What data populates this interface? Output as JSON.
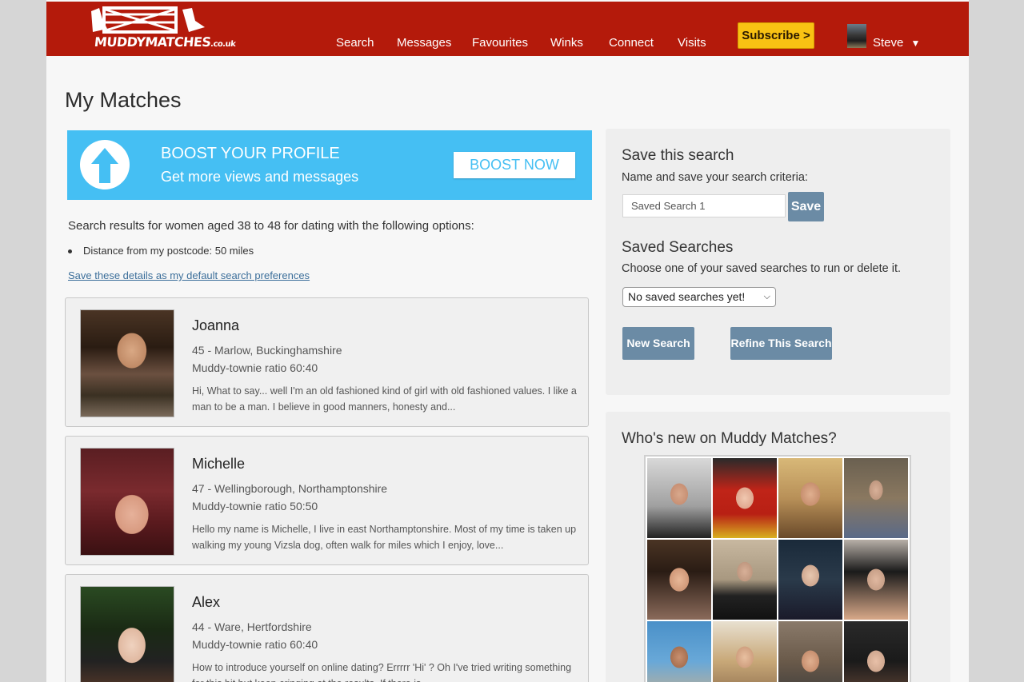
{
  "header": {
    "logo_text": "MUDDYMATCHES",
    "logo_domain": ".co.uk",
    "nav": [
      "Search",
      "Messages",
      "Favourites",
      "Winks",
      "Connect",
      "Visits"
    ],
    "subscribe_label": "Subscribe >",
    "user": {
      "name": "Steve",
      "caret": "▼"
    }
  },
  "main": {
    "title": "My Matches",
    "boost": {
      "heading": "BOOST YOUR PROFILE",
      "subheading": "Get more views and messages",
      "button": "BOOST NOW"
    },
    "results_text": "Search results for women aged 38 to 48 for dating with the following options:",
    "options": [
      "Distance from my postcode: 50 miles"
    ],
    "default_link": "Save these details as my default search preferences",
    "matches": [
      {
        "name": "Joanna",
        "location": "45 - Marlow, Buckinghamshire",
        "ratio": "Muddy-townie ratio 60:40",
        "bio": "Hi, What to say... well I'm an old fashioned kind of girl with old fashioned values. I like a man to be a man. I believe in good manners, honesty and..."
      },
      {
        "name": "Michelle",
        "location": "47 - Wellingborough, Northamptonshire",
        "ratio": "Muddy-townie ratio 50:50",
        "bio": "Hello my name is Michelle, I live in east Northamptonshire. Most of my time is taken up walking my young Vizsla dog, often walk for miles which I enjoy, love..."
      },
      {
        "name": "Alex",
        "location": "44 - Ware, Hertfordshire",
        "ratio": "Muddy-townie ratio 60:40",
        "bio": "How to introduce yourself on online dating? Errrrr 'Hi' ? Oh I've tried writing something for this bit but keep cringing at the results. If there is..."
      }
    ]
  },
  "sidebar": {
    "save_search": {
      "heading": "Save this search",
      "text": "Name and save your search criteria:",
      "input_value": "Saved Search 1",
      "save_label": "Save"
    },
    "saved_searches": {
      "heading": "Saved Searches",
      "text": "Choose one of your saved searches to run or delete it.",
      "select_value": "No saved searches yet!",
      "new_search_label": "New Search",
      "refine_label": "Refine This Search"
    },
    "whos_new": {
      "heading": "Who's new on Muddy Matches?"
    }
  },
  "colors": {
    "brand_red": "#b41a0b",
    "boost_blue": "#45bff3",
    "subscribe_yellow": "#f9c213",
    "button_slate": "#6b8ba5",
    "link_blue": "#3b6e9a"
  }
}
